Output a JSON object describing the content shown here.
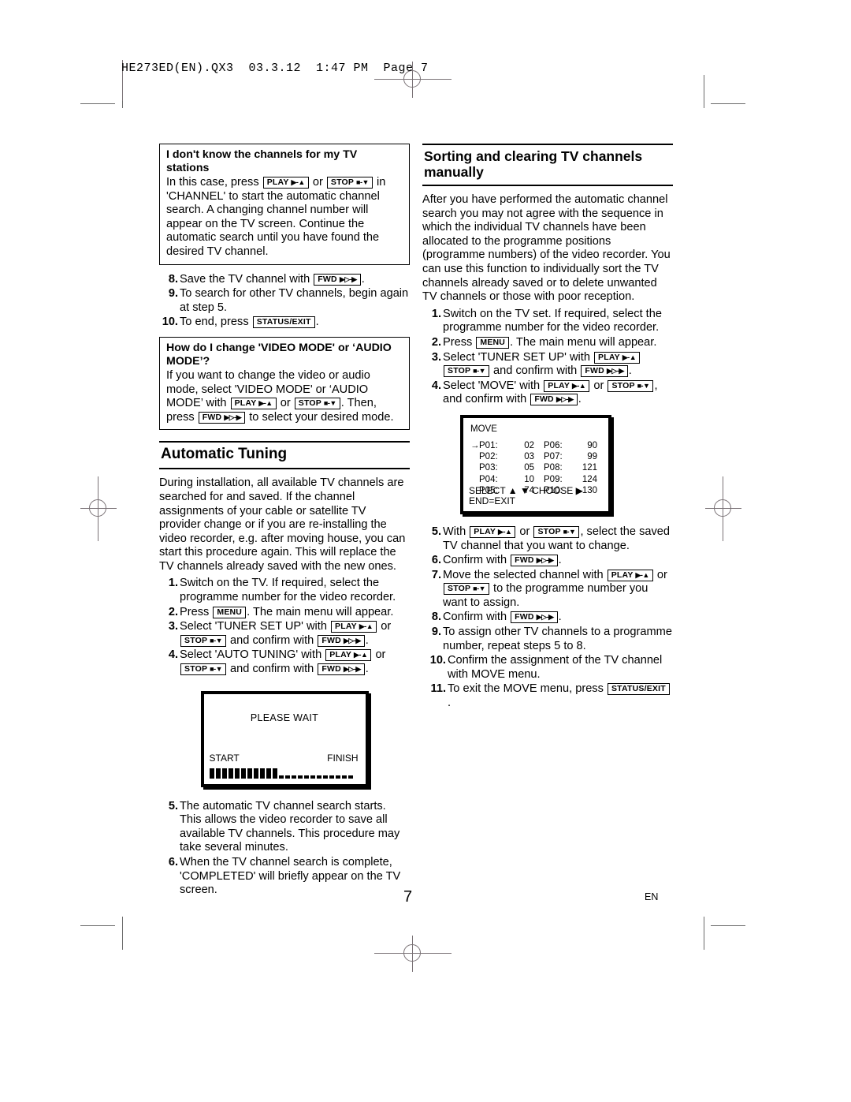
{
  "print_slug": "HE273ED(EN).QX3  03.3.12  1:47 PM  Page 7",
  "keys": {
    "play": "PLAY",
    "play_glyph": "▶-▲",
    "stop": "STOP",
    "stop_glyph": "■-▼",
    "fwd": "FWD",
    "fwd_glyph": "▶▷-▶",
    "menu": "MENU",
    "status_exit": "STATUS/EXIT"
  },
  "left_column": {
    "callout_channels": {
      "caption": "I don't know the channels for my TV stations",
      "text_1": "In this case, press",
      "text_2": "or",
      "text_3": "in 'CHANNEL' to start the automatic channel search. A changing channel number will appear on the TV screen. Continue the automatic search until you have found the desired TV channel."
    },
    "steps_continued": [
      {
        "num": "8.",
        "pre": "Save the TV channel with",
        "post": "."
      },
      {
        "num": "9.",
        "pre": "To search for other TV channels, begin again at step 5.",
        "post": ""
      },
      {
        "num": "10.",
        "pre": "To end, press",
        "post": "."
      }
    ],
    "callout_mode": {
      "caption": "How do I change 'VIDEO MODE' or ‘AUDIO MODE’?",
      "text_1": "If you want to change the video or audio mode, select 'VIDEO MODE' or ‘AUDIO MODE’ with",
      "text_2": "or",
      "text_3": ". Then, press",
      "text_4": "to select your desired mode."
    },
    "heading": "Automatic Tuning",
    "intro": "During installation, all available TV channels are searched for and saved. If the channel assignments of your cable or satellite TV provider change or if you are re-installing the video recorder, e.g. after moving house, you can start this procedure again. This will replace the TV channels already saved with the new ones.",
    "steps": [
      {
        "num": "1.",
        "text": "Switch on the TV. If required, select the programme number for the video recorder."
      },
      {
        "num": "2.",
        "pre": "Press",
        "mid": ". The main menu will appear."
      },
      {
        "num": "3.",
        "pre": "Select 'TUNER SET UP' with",
        "mid": "or",
        "mid2": "and confirm with",
        "post": "."
      },
      {
        "num": "4.",
        "pre": "Select 'AUTO TUNING' with",
        "mid": "or",
        "mid2": "and confirm with",
        "post": "."
      }
    ],
    "tv_wait": {
      "label": "PLEASE WAIT",
      "start": "START",
      "finish": "FINISH",
      "filled_segments": 11,
      "empty_segments": 12
    },
    "steps_after": [
      {
        "num": "5.",
        "text": "The automatic TV channel search starts. This allows the video recorder to save all available TV channels. This procedure may take several minutes."
      },
      {
        "num": "6.",
        "text": "When the TV channel search is complete, 'COMPLETED' will briefly appear on the TV screen."
      }
    ]
  },
  "right_column": {
    "heading_line1": "Sorting and clearing TV channels",
    "heading_line2": "manually",
    "intro": "After you have performed the automatic channel search you may not agree with the sequence in which the individual TV channels have been allocated to the programme positions (programme numbers) of the video recorder. You can use this function to individually sort the TV channels already saved or to delete unwanted TV channels or those with poor reception.",
    "steps_before": [
      {
        "num": "1.",
        "text": "Switch on the TV set. If required, select the programme number for the video recorder."
      },
      {
        "num": "2.",
        "pre": "Press",
        "mid": ". The main menu will appear."
      },
      {
        "num": "3.",
        "pre": "Select 'TUNER SET UP' with",
        "mid2": "and confirm with",
        "post": "."
      },
      {
        "num": "4.",
        "pre": "Select 'MOVE' with",
        "mid": "or",
        "mid2": "and confirm with",
        "post": "."
      }
    ],
    "tv_move": {
      "title": "MOVE",
      "cursor_row": 0,
      "cursor_glyph": "→",
      "rows": [
        {
          "left_label": "P01:",
          "left_value": "02",
          "right_label": "P06:",
          "right_value": "90"
        },
        {
          "left_label": "P02:",
          "left_value": "03",
          "right_label": "P07:",
          "right_value": "99"
        },
        {
          "left_label": "P03:",
          "left_value": "05",
          "right_label": "P08:",
          "right_value": "121"
        },
        {
          "left_label": "P04:",
          "left_value": "10",
          "right_label": "P09:",
          "right_value": "124"
        },
        {
          "left_label": "P05:",
          "left_value": "74",
          "right_label": "P10:",
          "right_value": "130"
        }
      ],
      "footer_line1": "SELECT ▲ ▼  CHOOSE ▶",
      "footer_line2": "END=EXIT"
    },
    "steps_after": [
      {
        "num": "5.",
        "pre": "With",
        "mid": "or",
        "post": ", select the saved TV channel that you want to change."
      },
      {
        "num": "6.",
        "pre": "Confirm with",
        "post": "."
      },
      {
        "num": "7.",
        "pre": "Move the selected channel with",
        "mid": "or",
        "mid2": "to the programme number you want to assign."
      },
      {
        "num": "8.",
        "pre": "Confirm with",
        "post": "."
      },
      {
        "num": "9.",
        "text": "To assign other TV channels to a programme number, repeat steps 5 to 8."
      },
      {
        "num": "10.",
        "text": "Confirm the assignment of the TV channel with MOVE menu."
      },
      {
        "num": "11.",
        "pre": "To exit the MOVE menu, press",
        "post": "."
      }
    ]
  },
  "footer": {
    "page_number": "7",
    "language": "EN"
  }
}
